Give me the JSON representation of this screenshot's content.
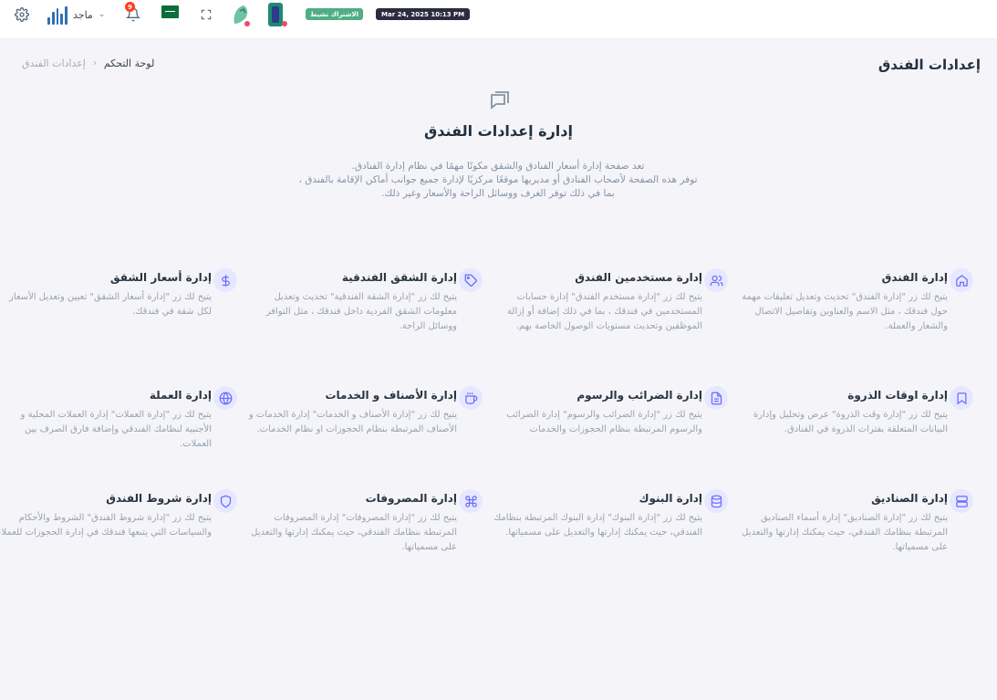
{
  "topbar": {
    "user_name": "ماجد",
    "notification_count": "9",
    "subscription_status": "الاشتراك نشيط",
    "datetime": "Mar 24, 2025 10:13 PM",
    "icons": [
      "gear-icon",
      "user-logo",
      "chevron-down-icon",
      "bell-icon",
      "saudi-flag",
      "fullscreen-icon",
      "mascot-logo",
      "mascot-logo"
    ]
  },
  "header": {
    "title": "إعدادات الفندق",
    "breadcrumb": {
      "home": "لوحة التحكم",
      "separator": "›",
      "current": "إعدادات الفندق"
    }
  },
  "hero": {
    "icon": "chat-icon",
    "title": "إدارة إعدادات الفندق",
    "desc_lines": [
      "تعد صفحة إدارة أسعار الفنادق والشقق مكونًا مهمًا في نظام إدارة الفنادق.",
      "توفر هذه الصفحة لأصحاب الفنادق أو مديريها موقعًا مركزيًا لإدارة جميع جوانب أماكن الإقامة بالفندق ،",
      "بما في ذلك توفر الغرف ووسائل الراحة والأسعار وغير ذلك."
    ]
  },
  "cards": [
    {
      "icon": "home-icon",
      "title": "إدارة الفندق",
      "desc": "يتيح لك زر \"إدارة الفندق\" تحديث وتعديل تعليقات مهمة حول فندقك ، مثل الاسم والعناوين وتفاصيل الاتصال والشعار والعملة."
    },
    {
      "icon": "users-icon",
      "title": "إدارة مستخدمين الفندق",
      "desc": "يتيح لك زر \"إدارة مستخدم الفندق\" إدارة حسابات المستخدمين في فندقك ، بما في ذلك إضافة أو إزالة الموظفين وتحديث مستويات الوصول الخاصة بهم."
    },
    {
      "icon": "tag-icon",
      "title": "إدارة الشقق الفندقية",
      "desc": "يتيح لك زر \"إدارة الشقة الفندقية\" تحديث وتعديل معلومات الشقق الفردية داخل فندقك ، مثل التوافر ووسائل الراحة."
    },
    {
      "icon": "dollar-icon",
      "title": "إدارة أسعار الشقق",
      "desc": "يتيح لك زر \"إدارة أسعار الشقق\" تعيين وتعديل الأسعار لكل شقة في فندقك."
    },
    {
      "icon": "bookmark-icon",
      "title": "إدارة اوقات الذروة",
      "desc": "يتيح لك زر \"إدارة وقت الذروة\" عرض وتحليل وإدارة البيانات المتعلقة بفترات الذروة في الفنادق."
    },
    {
      "icon": "document-icon",
      "title": "إدارة الضرائب والرسوم",
      "desc": "يتيح لك زر \"إدارة الضرائب والرسوم\" إدارة الضرائب والرسوم المرتبطة بنظام الحجوزات والخدمات"
    },
    {
      "icon": "coffee-cup-icon",
      "title": "إدارة الأصناف و الخدمات",
      "desc": "يتيح لك زر \"إدارة الأصناف و الخدمات\" إدارة الخدمات و الأصناف المرتبطة بنظام الحجوزات او نظام الخدمات."
    },
    {
      "icon": "globe-icon",
      "title": "إدارة العملة",
      "desc": "يتيح لك زر \"إدارة العملات\" إدارة العملات المحلية و الأجنبية لنظامك الفندقي وإضافة فارق الصرف بين العملات."
    },
    {
      "icon": "server-icon",
      "title": "إدارة الصناديق",
      "desc": "يتيح لك زر \"إدارة الصناديق\" إدارة أسماء الصناديق المرتبطة بنظامك الفندقي، حيث يمكنك إدارتها والتعديل على مسمياتها."
    },
    {
      "icon": "database-icon",
      "title": "إدارة البنوك",
      "desc": "يتيح لك زر \"إدارة البنوك\" إدارة البنوك المرتبطة بنظامك الفندقي، حيث يمكنك إدارتها والتعديل على مسمياتها."
    },
    {
      "icon": "command-icon",
      "title": "إدارة المصروفات",
      "desc": "يتيح لك زر \"إدارة المصروفات\" إدارة المصروفات المرتبطة بنظامك الفندقي، حيث يمكنك إدارتها والتعديل على مسمياتها."
    },
    {
      "icon": "shield-icon",
      "title": "إدارة شروط الفندق",
      "desc": "يتيح لك زر \"إدارة شروط الفندق\" الشروط والأحكام والسياسات التي يتبعها فندقك في إدارة الحجوزات للعملاء."
    }
  ],
  "colors": {
    "accent": "#696cff",
    "accent_soft": "#e7e7ff",
    "page_bg": "#f5f5f9",
    "subscription_badge": "#4fae86",
    "date_badge": "#2b2c40",
    "notification_badge": "#ff3e1d"
  }
}
